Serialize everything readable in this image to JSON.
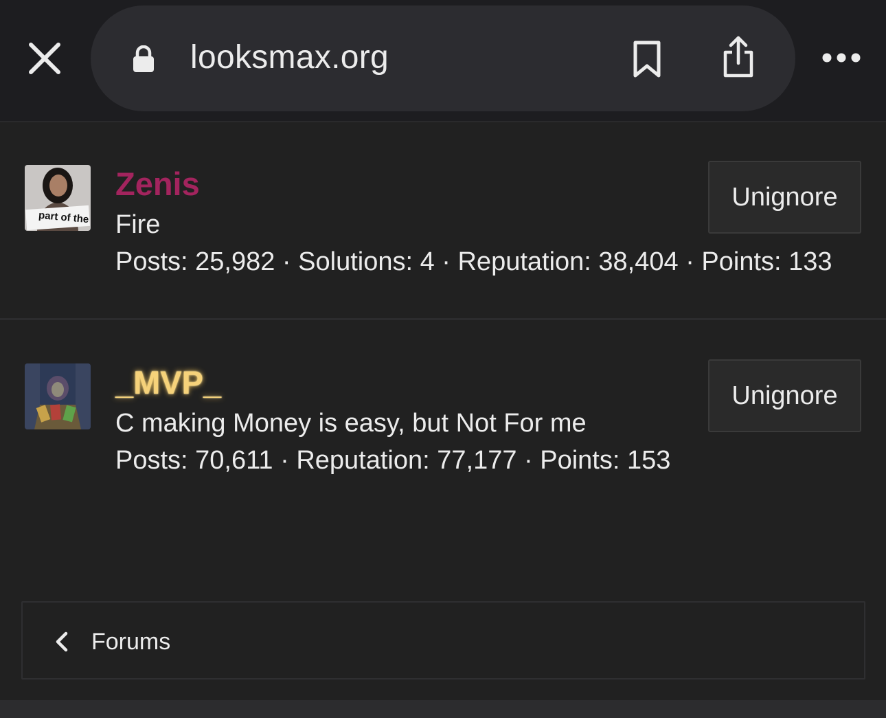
{
  "browser": {
    "url": "looksmax.org",
    "close_icon": "close-icon",
    "lock_icon": "lock-icon",
    "bookmark_icon": "bookmark-icon",
    "share_icon": "share-icon",
    "more_icon": "more-icon"
  },
  "members": [
    {
      "username": "Zenis",
      "username_color": "#a3245e",
      "title": "Fire",
      "stats": "Posts: 25,982 · Solutions: 4 · Reputation: 38,404 · Points: 133",
      "avatar_caption": "part of the",
      "button_label": "Unignore"
    },
    {
      "username": "_MVP_",
      "username_color": "#f6d27a",
      "title": "C making Money is easy, but Not For me",
      "stats": "Posts: 70,611 · Reputation: 77,177 · Points: 153",
      "button_label": "Unignore"
    }
  ],
  "breadcrumb": {
    "icon": "chevron-left-icon",
    "label": "Forums"
  }
}
